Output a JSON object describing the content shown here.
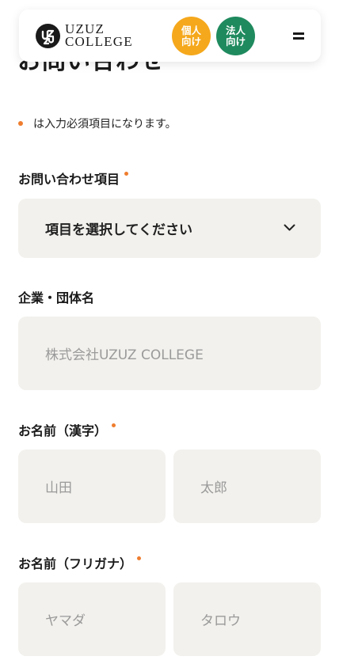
{
  "page": {
    "heading": "お問い合わせ"
  },
  "header": {
    "logo": {
      "line1": "UZUZ",
      "line2": "COLLEGE"
    },
    "badges": {
      "individual": {
        "line1": "個人",
        "line2": "向け",
        "color": "#f5a81c"
      },
      "corporate": {
        "line1": "法人",
        "line2": "向け",
        "color": "#1f8a5e"
      }
    },
    "menu_icon": "hamburger-icon"
  },
  "form": {
    "required_note": "は入力必須項目になります。",
    "required_color": "#ef7d2e",
    "inquiry_type": {
      "label": "お問い合わせ項目",
      "value": "項目を選択してください",
      "icon": "chevron-down-icon"
    },
    "company": {
      "label": "企業・団体名",
      "placeholder": "株式会社UZUZ COLLEGE"
    },
    "name_kanji": {
      "label": "お名前（漢字）",
      "last_placeholder": "山田",
      "first_placeholder": "太郎"
    },
    "name_kana": {
      "label": "お名前（フリガナ）",
      "last_placeholder": "ヤマダ",
      "first_placeholder": "タロウ"
    }
  }
}
